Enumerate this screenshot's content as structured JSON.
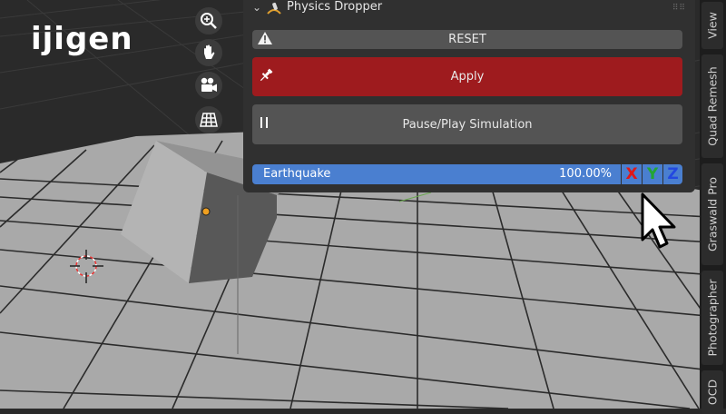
{
  "logo": {
    "text": "ijigen"
  },
  "nav_tools": [
    {
      "name": "zoom-icon"
    },
    {
      "name": "hand-pan-icon"
    },
    {
      "name": "camera-icon"
    },
    {
      "name": "ortho-grid-icon"
    }
  ],
  "panel": {
    "title": "Physics Dropper",
    "reset_label": "RESET",
    "apply_label": "Apply",
    "pause_label": "Pause/Play Simulation",
    "earthquake": {
      "label": "Earthquake",
      "value_text": "100.00%",
      "value": 1.0
    },
    "axes": {
      "x": "X",
      "y": "Y",
      "z": "Z"
    }
  },
  "sidebar_tabs": [
    "View",
    "Quad Remesh",
    "Graswald Pro",
    "Photographer",
    "OCD"
  ],
  "colors": {
    "apply": "#9e1b1e",
    "slider": "#4a7fd0",
    "axis_x": "#e01818",
    "axis_y": "#23a534",
    "axis_z": "#2348e0",
    "panel": "#303030"
  }
}
